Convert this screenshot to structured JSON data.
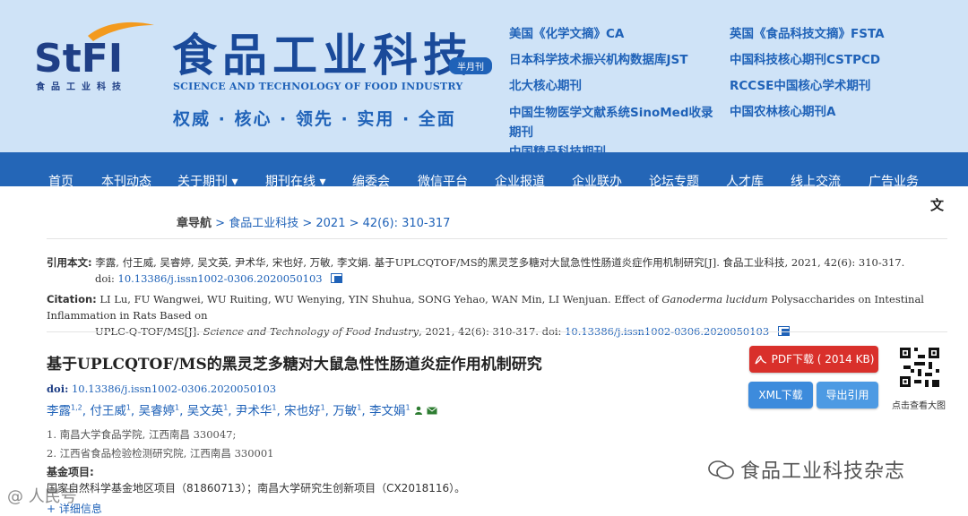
{
  "header": {
    "logo_text": "StFI",
    "logo_sub": "食品工业科技",
    "brand_cn": "食品工业科技",
    "badge": "半月刊",
    "brand_en": "SCIENCE AND TECHNOLOGY OF FOOD INDUSTRY",
    "slogan": "权威 · 核心 · 领先 · 实用 · 全面",
    "indexes_left": [
      "美国《化学文摘》CA",
      "日本科学技术振兴机构数据库JST",
      "北大核心期刊",
      "中国生物医学文献系统SinoMed收录期刊",
      "中国精品科技期刊"
    ],
    "indexes_right": [
      "英国《食品科技文摘》FSTA",
      "中国科技核心期刊CSTPCD",
      "RCCSE中国核心学术期刊",
      "中国农林核心期刊A"
    ]
  },
  "nav": {
    "items": [
      "首页",
      "本刊动态",
      "关于期刊 ▾",
      "期刊在线 ▾",
      "编委会",
      "微信平台",
      "企业报道",
      "企业联办",
      "论坛专题",
      "人才库",
      "线上交流",
      "广告业务"
    ]
  },
  "breadcrumb": {
    "label": "章导航",
    "journal": "食品工业科技",
    "year": "2021",
    "issue": "42(6): 310-317"
  },
  "lang_toggle": "文",
  "cite_cn": {
    "label": "引用本文:",
    "text": "李露, 付王威, 吴睿婷, 吴文英, 尹术华, 宋也好, 万敏, 李文娟. 基于UPLCQTOF/MS的黑灵芝多糖对大鼠急性性肠道炎症作用机制研究[J]. 食品工业科技, 2021, 42(6): 310-317.",
    "doi_prefix": "doi:",
    "doi": "10.13386/j.issn1002-0306.2020050103"
  },
  "cite_en": {
    "label": "Citation:",
    "text1": "LI Lu, FU Wangwei, WU Ruiting, WU Wenying, YIN Shuhua, SONG Yehao, WAN Min, LI Wenjuan. Effect of",
    "species": "Ganoderma lucidum",
    "text2": "Polysaccharides on Intestinal Inflammation in Rats Based on",
    "text3": "UPLC-Q-TOF/MS[J].",
    "journal": "Science and Technology of Food Industry",
    "text4": ", 2021, 42(6): 310-317. doi:",
    "doi": "10.13386/j.issn1002-0306.2020050103"
  },
  "article": {
    "title": "基于UPLCQTOF/MS的黑灵芝多糖对大鼠急性性肠道炎症作用机制研究",
    "doi_label": "doi:",
    "doi": "10.13386/j.issn1002-0306.2020050103",
    "authors": [
      {
        "name": "李露",
        "sup": "1,2"
      },
      {
        "name": "付王威",
        "sup": "1"
      },
      {
        "name": "吴睿婷",
        "sup": "1"
      },
      {
        "name": "吴文英",
        "sup": "1"
      },
      {
        "name": "尹术华",
        "sup": "1"
      },
      {
        "name": "宋也好",
        "sup": "1"
      },
      {
        "name": "万敏",
        "sup": "1"
      },
      {
        "name": "李文娟",
        "sup": "1"
      }
    ],
    "affiliations": [
      "1. 南昌大学食品学院, 江西南昌 330047;",
      "2. 江西省食品检验检测研究院, 江西南昌 330001"
    ],
    "fund_label": "基金项目:",
    "fund_text": "国家自然科学基金地区项目（81860713）；南昌大学研究生创新项目（CX2018116）。",
    "more": "+ 详细信息"
  },
  "actions": {
    "pdf": "PDF下载 ( 2014 KB)",
    "xml": "XML下载",
    "export": "导出引用",
    "qr_caption": "点击查看大图"
  },
  "watermarks": {
    "right": "食品工业科技杂志",
    "left": "@ 人民号"
  },
  "colors": {
    "header_bg": "#cfe3f7",
    "nav_bg": "#2466b7",
    "link": "#1f62b8",
    "pdf_btn": "#d9302b",
    "xml_btn": "#3d8bdc",
    "logo_orange": "#f39a1e"
  }
}
